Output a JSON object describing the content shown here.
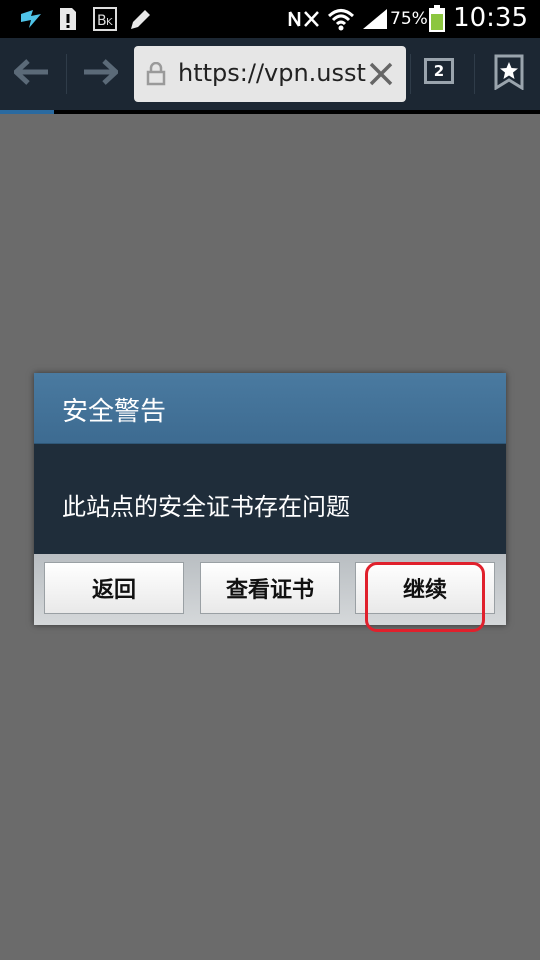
{
  "status_bar": {
    "battery_percent": "75%",
    "time": "10:35",
    "icons": [
      "swype-icon",
      "sim-alert-icon",
      "keyboard-icon",
      "pen-icon",
      "nfc-off-icon",
      "wifi-icon",
      "signal-icon",
      "battery-icon"
    ]
  },
  "browser": {
    "url": "https://vpn.usst.e",
    "tab_count": "2",
    "page_load_progress": 0.1
  },
  "dialog": {
    "title": "安全警告",
    "message": "此站点的安全证书存在问题",
    "buttons": {
      "back": "返回",
      "view_cert": "查看证书",
      "continue": "继续"
    }
  },
  "colors": {
    "page_background": "#6b6b6b",
    "dialog_title_bg": "#4a7aa0",
    "dialog_body_bg": "#1f2d3a",
    "highlight": "#e0202c"
  }
}
